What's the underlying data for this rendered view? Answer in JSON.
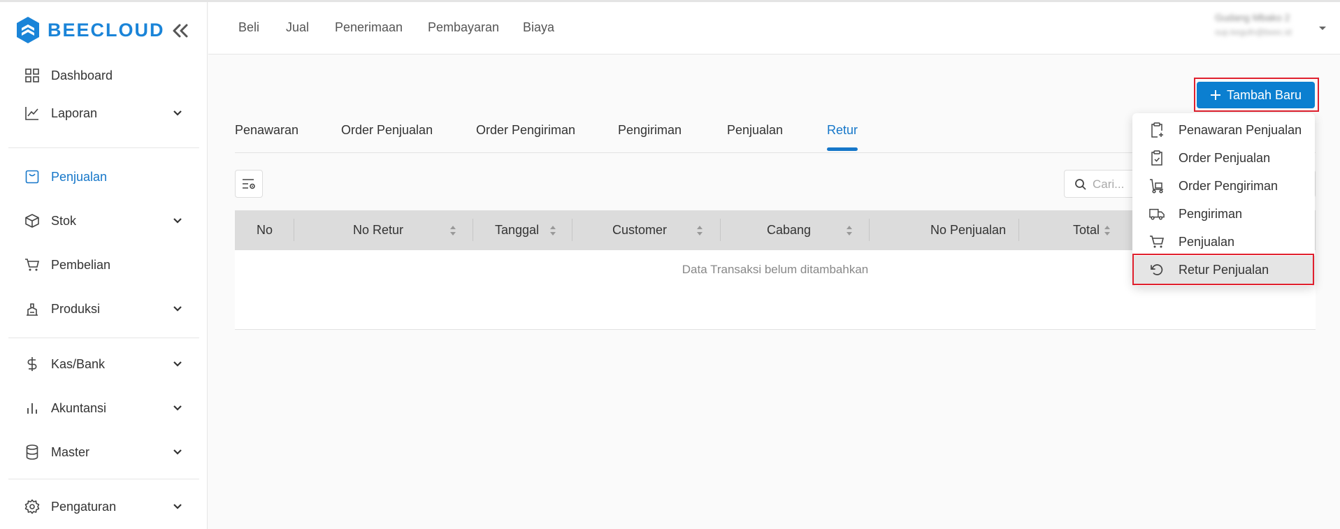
{
  "app": {
    "name": "BEECLOUD",
    "brand_color": "#1a84d8",
    "accent_color": "#0b7fd0",
    "highlight_color": "#e0202e"
  },
  "sidebar": {
    "items": [
      {
        "label": "Dashboard",
        "icon": "dashboard-icon",
        "expandable": false
      },
      {
        "label": "Laporan",
        "icon": "chart-line-icon",
        "expandable": true
      },
      {
        "label": "Penjualan",
        "icon": "sales-tag-icon",
        "expandable": false,
        "active": true
      },
      {
        "label": "Stok",
        "icon": "box-icon",
        "expandable": true
      },
      {
        "label": "Pembelian",
        "icon": "cart-icon",
        "expandable": false
      },
      {
        "label": "Produksi",
        "icon": "factory-icon",
        "expandable": true
      },
      {
        "label": "Kas/Bank",
        "icon": "dollar-icon",
        "expandable": true
      },
      {
        "label": "Akuntansi",
        "icon": "bar-chart-icon",
        "expandable": true
      },
      {
        "label": "Master",
        "icon": "database-icon",
        "expandable": true
      },
      {
        "label": "Pengaturan",
        "icon": "gear-icon",
        "expandable": true
      }
    ]
  },
  "header": {
    "nav": [
      "Beli",
      "Jual",
      "Penerimaan",
      "Pembayaran",
      "Biaya"
    ],
    "user_name": "Gudang Mbako 2",
    "user_email": "sup.kegufn@beec.id"
  },
  "main": {
    "add_button": "Tambah Baru",
    "tabs": [
      "Penawaran",
      "Order Penjualan",
      "Order Pengiriman",
      "Pengiriman",
      "Penjualan",
      "Retur"
    ],
    "active_tab": "Retur",
    "search_placeholder": "Cari...",
    "columns": [
      "No",
      "No Retur",
      "Tanggal",
      "Customer",
      "Cabang",
      "No Penjualan",
      "Total"
    ],
    "empty_text": "Data Transaksi belum ditambahkan"
  },
  "dropdown": {
    "items": [
      {
        "label": "Penawaran Penjualan",
        "icon": "clipboard-plus-icon"
      },
      {
        "label": "Order Penjualan",
        "icon": "clipboard-check-icon"
      },
      {
        "label": "Order Pengiriman",
        "icon": "hand-truck-icon"
      },
      {
        "label": "Pengiriman",
        "icon": "truck-icon"
      },
      {
        "label": "Penjualan",
        "icon": "cart-icon"
      },
      {
        "label": "Retur Penjualan",
        "icon": "undo-icon",
        "highlighted": true
      }
    ]
  }
}
